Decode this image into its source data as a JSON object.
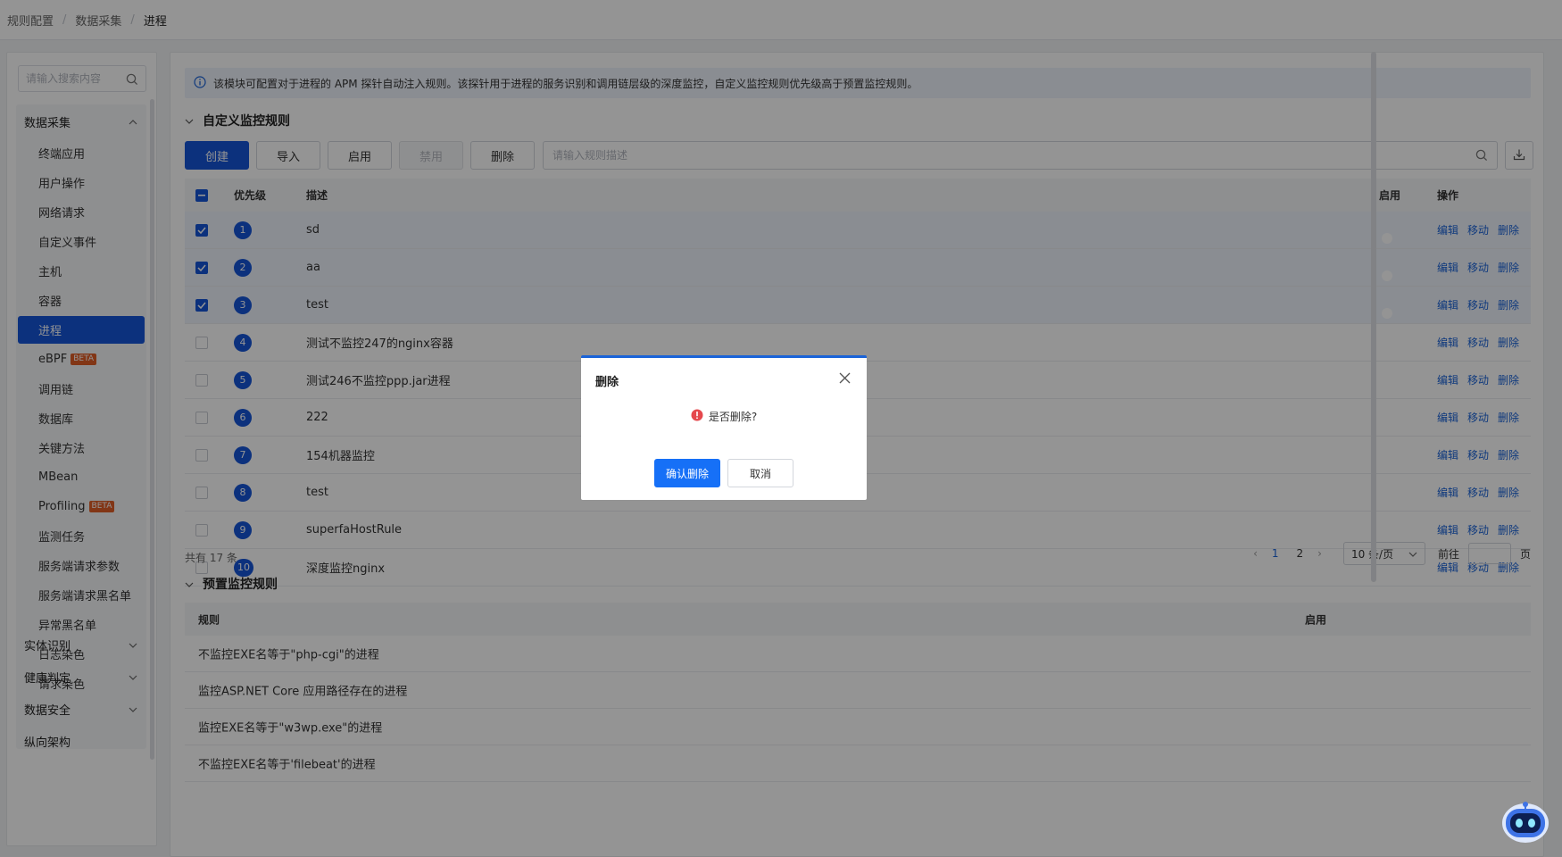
{
  "breadcrumb": [
    "规则配置",
    "数据采集",
    "进程"
  ],
  "sidebar": {
    "search_placeholder": "请输入搜索内容",
    "open_group": {
      "label": "数据采集",
      "items": [
        {
          "label": "终端应用"
        },
        {
          "label": "用户操作"
        },
        {
          "label": "网络请求"
        },
        {
          "label": "自定义事件"
        },
        {
          "label": "主机"
        },
        {
          "label": "容器"
        },
        {
          "label": "进程",
          "active": true
        },
        {
          "label": "eBPF",
          "badge": "BETA"
        },
        {
          "label": "调用链"
        },
        {
          "label": "数据库"
        },
        {
          "label": "关键方法"
        },
        {
          "label": "MBean"
        },
        {
          "label": "Profiling",
          "badge": "BETA"
        },
        {
          "label": "监测任务"
        },
        {
          "label": "服务端请求参数"
        },
        {
          "label": "服务端请求黑名单"
        },
        {
          "label": "异常黑名单"
        },
        {
          "label": "日志染色"
        },
        {
          "label": "请求染色"
        }
      ]
    },
    "collapsed_groups": [
      "实体识别",
      "健康判定",
      "数据安全",
      "纵向架构"
    ]
  },
  "info_text": "该模块可配置对于进程的 APM 探针自动注入规则。该探针用于进程的服务识别和调用链层级的深度监控，自定义监控规则优先级高于预置监控规则。",
  "custom_section": {
    "title": "自定义监控规则",
    "buttons": {
      "create": "创建",
      "import": "导入",
      "enable": "启用",
      "disable": "禁用",
      "delete": "删除"
    },
    "filter_placeholder": "请输入规则描述",
    "columns": {
      "priority": "优先级",
      "desc": "描述",
      "enable": "启用",
      "ops": "操作"
    },
    "ops_labels": {
      "edit": "编辑",
      "move": "移动",
      "delete": "删除"
    },
    "rows": [
      {
        "priority": "1",
        "desc": "sd",
        "checked": true,
        "enabled": false
      },
      {
        "priority": "2",
        "desc": "aa",
        "checked": true,
        "enabled": false
      },
      {
        "priority": "3",
        "desc": "test",
        "checked": true,
        "enabled": false
      },
      {
        "priority": "4",
        "desc": "测试不监控247的nginx容器",
        "checked": false,
        "enabled": false
      },
      {
        "priority": "5",
        "desc": "测试246不监控ppp.jar进程",
        "checked": false,
        "enabled": false
      },
      {
        "priority": "6",
        "desc": "222",
        "checked": false,
        "enabled": false
      },
      {
        "priority": "7",
        "desc": "154机器监控",
        "checked": false,
        "enabled": false
      },
      {
        "priority": "8",
        "desc": "test",
        "checked": false,
        "enabled": false
      },
      {
        "priority": "9",
        "desc": "superfaHostRule",
        "checked": false,
        "enabled": true
      },
      {
        "priority": "10",
        "desc": "深度监控nginx",
        "checked": false,
        "enabled": false
      }
    ],
    "pagination": {
      "total_text": "共有 17 条",
      "pages": [
        "1",
        "2"
      ],
      "current": "1",
      "page_size": "10 条/页",
      "goto_label": "前往",
      "goto_suffix": "页"
    }
  },
  "preset_section": {
    "title": "预置监控规则",
    "columns": {
      "rule": "规则",
      "enable": "启用"
    },
    "rows": [
      {
        "rule": "不监控EXE名等于\"php-cgi\"的进程",
        "enabled": true
      },
      {
        "rule": "监控ASP.NET Core 应用路径存在的进程",
        "enabled": true
      },
      {
        "rule": "监控EXE名等于\"w3wp.exe\"的进程",
        "enabled": true
      },
      {
        "rule": "不监控EXE名等于'filebeat'的进程",
        "enabled": true
      }
    ]
  },
  "modal": {
    "title": "删除",
    "message": "是否删除?",
    "confirm": "确认删除",
    "cancel": "取消"
  },
  "colors": {
    "primary": "#1555d8",
    "danger": "#e5484d",
    "link": "#1a63d8"
  }
}
